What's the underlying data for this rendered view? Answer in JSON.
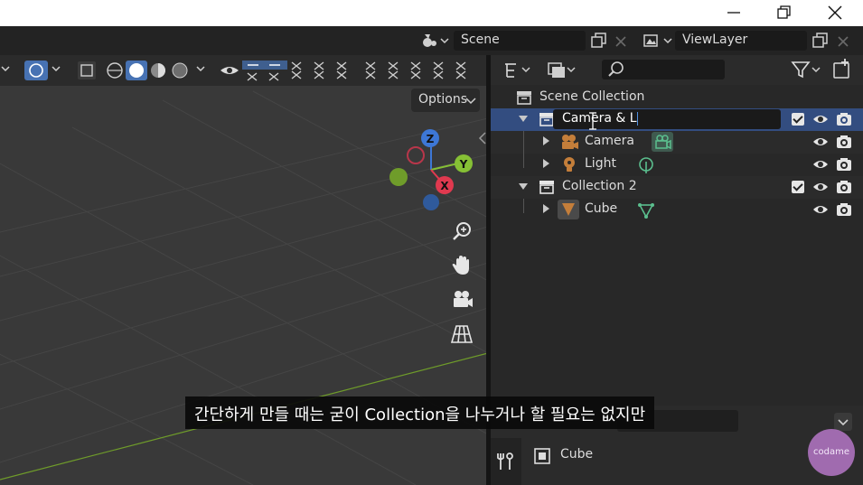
{
  "window": {
    "minimize_glyph": "minimize-icon",
    "restore_glyph": "restore-icon",
    "close_glyph": "close-icon"
  },
  "topbar": {
    "scene_name": "Scene",
    "view_layer_name": "ViewLayer"
  },
  "viewport": {
    "options_label": "Options",
    "gizmo": {
      "z": "Z",
      "y": "Y",
      "x": "X"
    },
    "colors": {
      "x_axis": "#e0394f",
      "y_axis": "#86c035",
      "z_axis": "#3d77d6",
      "grid_line_x": "#6f9c2a"
    }
  },
  "outliner": {
    "scene_collection_label": "Scene Collection",
    "rename_value": "Camera & L",
    "items": [
      {
        "label": "Camera"
      },
      {
        "label": "Light"
      },
      {
        "label": "Collection 2"
      },
      {
        "label": "Cube"
      }
    ],
    "colors": {
      "selected_row": "#334d80",
      "object_icon": "#c47e3a",
      "data_icon": "#5bbf8e"
    }
  },
  "properties": {
    "object_name": "Cube"
  },
  "subtitle": {
    "text": "간단하게 만들 때는 굳이 Collection을 나누거나 할 필요는 없지만"
  },
  "watermark": {
    "text": "codame"
  }
}
